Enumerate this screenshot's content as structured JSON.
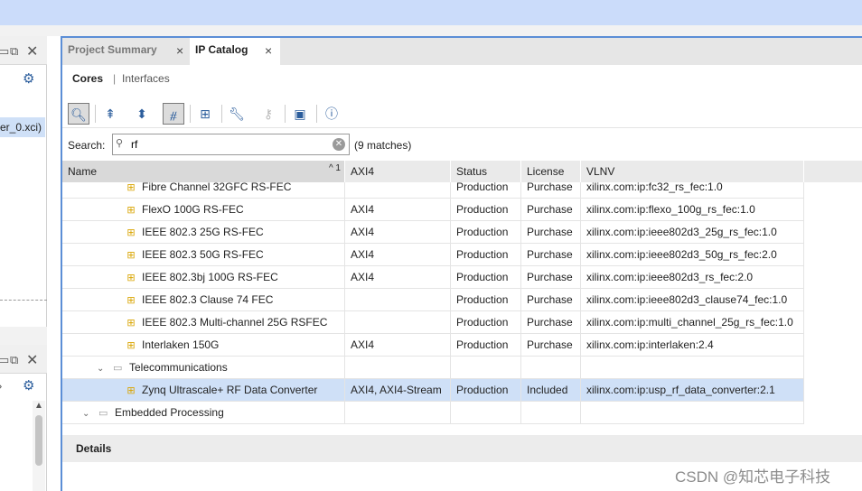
{
  "left_panel": {
    "file_label": "er_0.xci)"
  },
  "tabs": [
    {
      "label": "Project Summary",
      "active": false
    },
    {
      "label": "IP Catalog",
      "active": true
    }
  ],
  "subtabs": {
    "cores": "Cores",
    "separator": "|",
    "interfaces": "Interfaces"
  },
  "toolbar": {
    "icons": [
      "search-icon",
      "collapse-all-icon",
      "expand-all-icon",
      "filter-icon",
      "hierarchy-icon",
      "wrench-icon",
      "key-icon",
      "chip-icon",
      "info-icon"
    ]
  },
  "search": {
    "label": "Search:",
    "value": "rf",
    "matches": "(9 matches)"
  },
  "table": {
    "columns": [
      "Name",
      "AXI4",
      "Status",
      "License",
      "VLNV"
    ],
    "sort_indicator": "^ 1",
    "rows": [
      {
        "name": "Fibre Channel 32GFC RS-FEC",
        "axi": "",
        "status": "Production",
        "license": "Purchase",
        "vlnv": "xilinx.com:ip:fc32_rs_fec:1.0",
        "kind": "ip"
      },
      {
        "name": "FlexO 100G RS-FEC",
        "axi": "AXI4",
        "status": "Production",
        "license": "Purchase",
        "vlnv": "xilinx.com:ip:flexo_100g_rs_fec:1.0",
        "kind": "ip"
      },
      {
        "name": "IEEE 802.3 25G RS-FEC",
        "axi": "AXI4",
        "status": "Production",
        "license": "Purchase",
        "vlnv": "xilinx.com:ip:ieee802d3_25g_rs_fec:1.0",
        "kind": "ip"
      },
      {
        "name": "IEEE 802.3 50G RS-FEC",
        "axi": "AXI4",
        "status": "Production",
        "license": "Purchase",
        "vlnv": "xilinx.com:ip:ieee802d3_50g_rs_fec:2.0",
        "kind": "ip"
      },
      {
        "name": "IEEE 802.3bj 100G RS-FEC",
        "axi": "AXI4",
        "status": "Production",
        "license": "Purchase",
        "vlnv": "xilinx.com:ip:ieee802d3_rs_fec:2.0",
        "kind": "ip"
      },
      {
        "name": "IEEE 802.3 Clause 74 FEC",
        "axi": "",
        "status": "Production",
        "license": "Purchase",
        "vlnv": "xilinx.com:ip:ieee802d3_clause74_fec:1.0",
        "kind": "ip"
      },
      {
        "name": "IEEE 802.3 Multi-channel 25G RSFEC",
        "axi": "",
        "status": "Production",
        "license": "Purchase",
        "vlnv": "xilinx.com:ip:multi_channel_25g_rs_fec:1.0",
        "kind": "ip"
      },
      {
        "name": "Interlaken 150G",
        "axi": "AXI4",
        "status": "Production",
        "license": "Purchase",
        "vlnv": "xilinx.com:ip:interlaken:2.4",
        "kind": "ip"
      },
      {
        "name": "Telecommunications",
        "axi": "",
        "status": "",
        "license": "",
        "vlnv": "",
        "kind": "folder"
      },
      {
        "name": "Zynq Ultrascale+ RF Data Converter",
        "axi": "AXI4, AXI4-Stream",
        "status": "Production",
        "license": "Included",
        "vlnv": "xilinx.com:ip:usp_rf_data_converter:2.1",
        "kind": "ip",
        "selected": true
      },
      {
        "name": "Embedded Processing",
        "axi": "",
        "status": "",
        "license": "",
        "vlnv": "",
        "kind": "folder-top"
      }
    ]
  },
  "details": {
    "label": "Details"
  },
  "watermark": "CSDN @知芯电子科技"
}
